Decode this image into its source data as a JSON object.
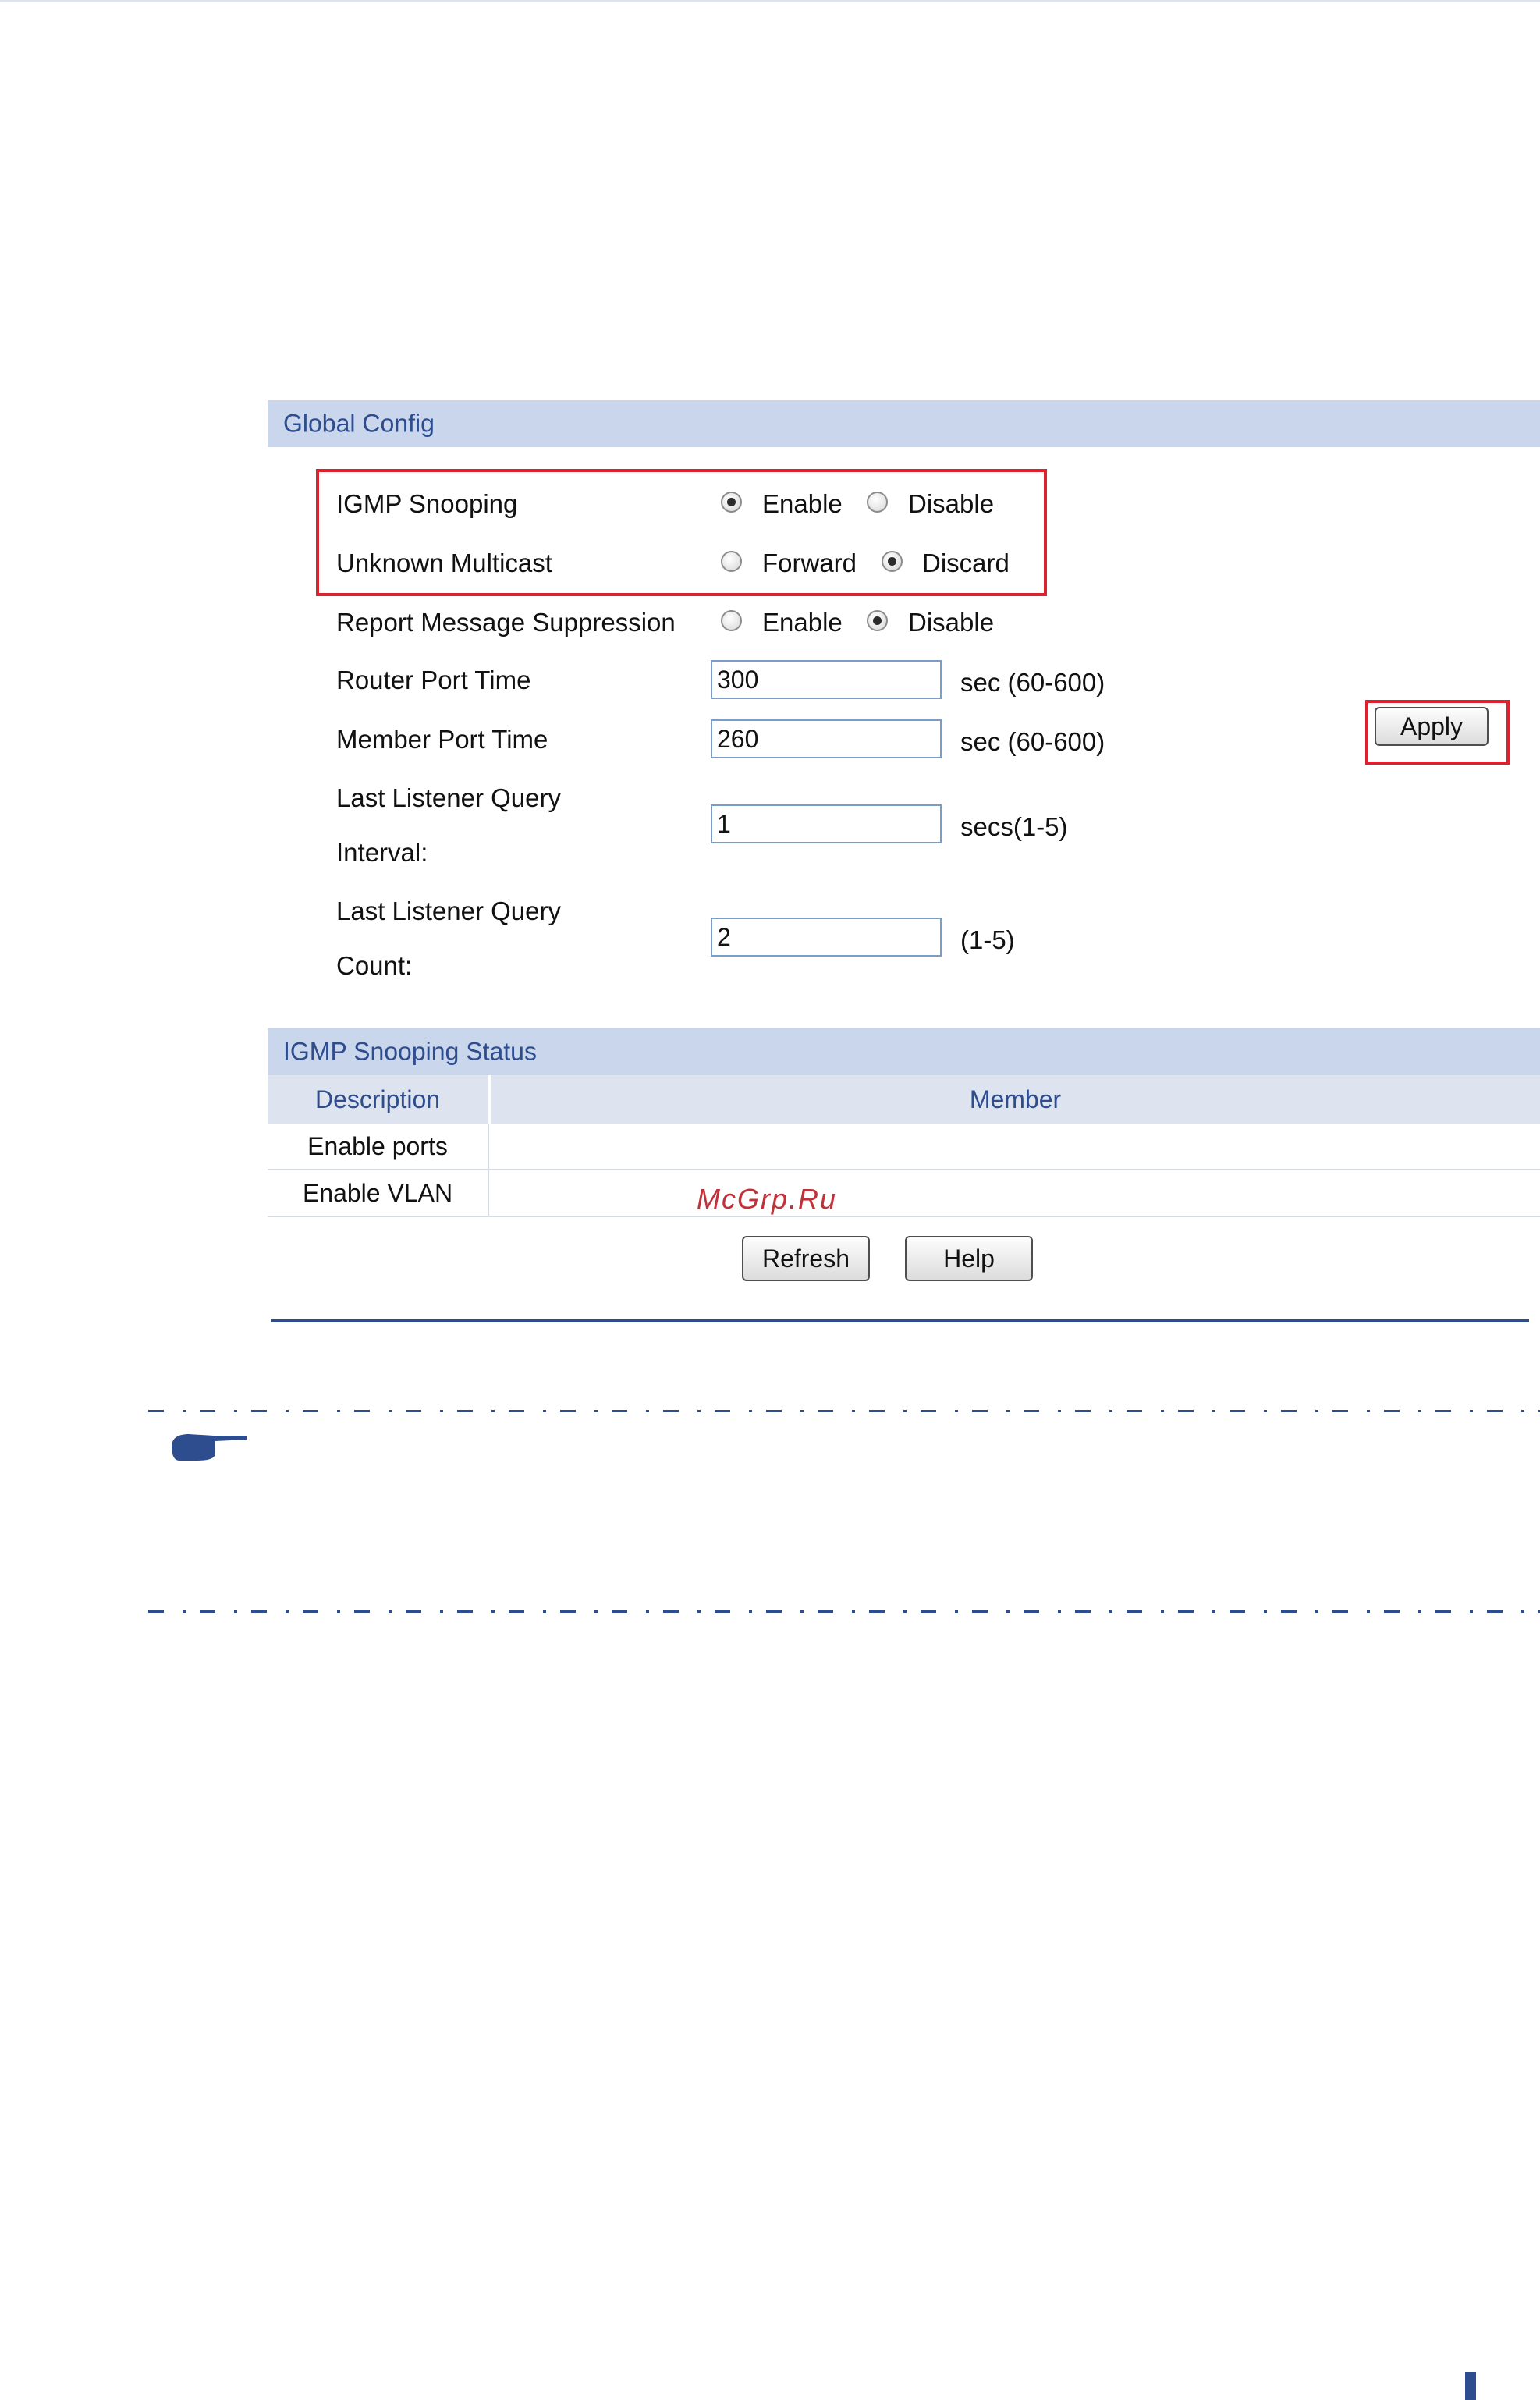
{
  "global_config": {
    "title": "Global Config",
    "igmp_snooping": {
      "label": "IGMP Snooping",
      "options": [
        "Enable",
        "Disable"
      ],
      "selected": "Enable"
    },
    "unknown_multicast": {
      "label": "Unknown Multicast",
      "options": [
        "Forward",
        "Discard"
      ],
      "selected": "Discard"
    },
    "report_suppression": {
      "label": "Report Message Suppression",
      "options": [
        "Enable",
        "Disable"
      ],
      "selected": "Disable"
    },
    "router_port_time": {
      "label": "Router Port Time",
      "value": "300",
      "unit": "sec (60-600)"
    },
    "member_port_time": {
      "label": "Member Port Time",
      "value": "260",
      "unit": "sec (60-600)"
    },
    "last_listener_interval": {
      "label_line1": "Last Listener Query",
      "label_line2": "Interval:",
      "value": "1",
      "unit": "secs(1-5)"
    },
    "last_listener_count": {
      "label_line1": "Last Listener Query",
      "label_line2": "Count:",
      "value": "2",
      "unit": "(1-5)"
    },
    "apply_label": "Apply"
  },
  "status": {
    "title": "IGMP Snooping Status",
    "columns": [
      "Description",
      "Member"
    ],
    "rows": [
      {
        "description": "Enable ports",
        "member": ""
      },
      {
        "description": "Enable VLAN",
        "member": ""
      }
    ]
  },
  "buttons": {
    "refresh": "Refresh",
    "help": "Help"
  },
  "watermark": "McGrp.Ru",
  "colors": {
    "header_bg": "#c9d6ec",
    "header_text": "#2e4d8f",
    "highlight": "#d9232e"
  }
}
